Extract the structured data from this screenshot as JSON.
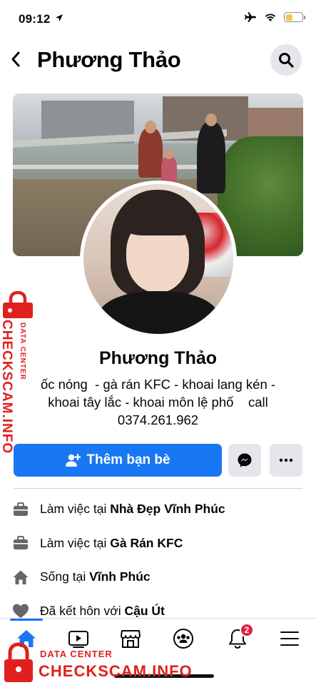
{
  "status_bar": {
    "time": "09:12"
  },
  "header": {
    "title": "Phương Thảo"
  },
  "profile": {
    "name": "Phương Thảo",
    "bio_lines": [
      "ốc nóng  - gà rán KFC - khoai lang kén -",
      "khoai tây lắc - khoai môn lệ phố    call",
      "0374.261.962"
    ]
  },
  "actions": {
    "add_friend_label": "Thêm bạn bè"
  },
  "details": [
    {
      "icon": "briefcase-icon",
      "prefix": "Làm việc tại ",
      "value": "Nhà Đẹp Vĩnh Phúc"
    },
    {
      "icon": "briefcase-icon",
      "prefix": "Làm việc tại ",
      "value": "Gà Rán KFC"
    },
    {
      "icon": "home-icon",
      "prefix": "Sống tại ",
      "value": "Vĩnh Phúc"
    },
    {
      "icon": "heart-icon",
      "prefix": "Đã kết hôn với ",
      "value": "Cậu Út"
    }
  ],
  "tabbar": {
    "active": "home",
    "notifications_count": "2",
    "tabs": [
      "home-tab",
      "watch-tab",
      "marketplace-tab",
      "groups-tab",
      "notifications-tab",
      "menu-tab"
    ]
  },
  "watermark": {
    "small": "DATA CENTER",
    "big": "CHECKSCAM.INFO"
  },
  "colors": {
    "accent": "#1877f2",
    "badge": "#e41e3f",
    "watermark": "#e0201f"
  }
}
